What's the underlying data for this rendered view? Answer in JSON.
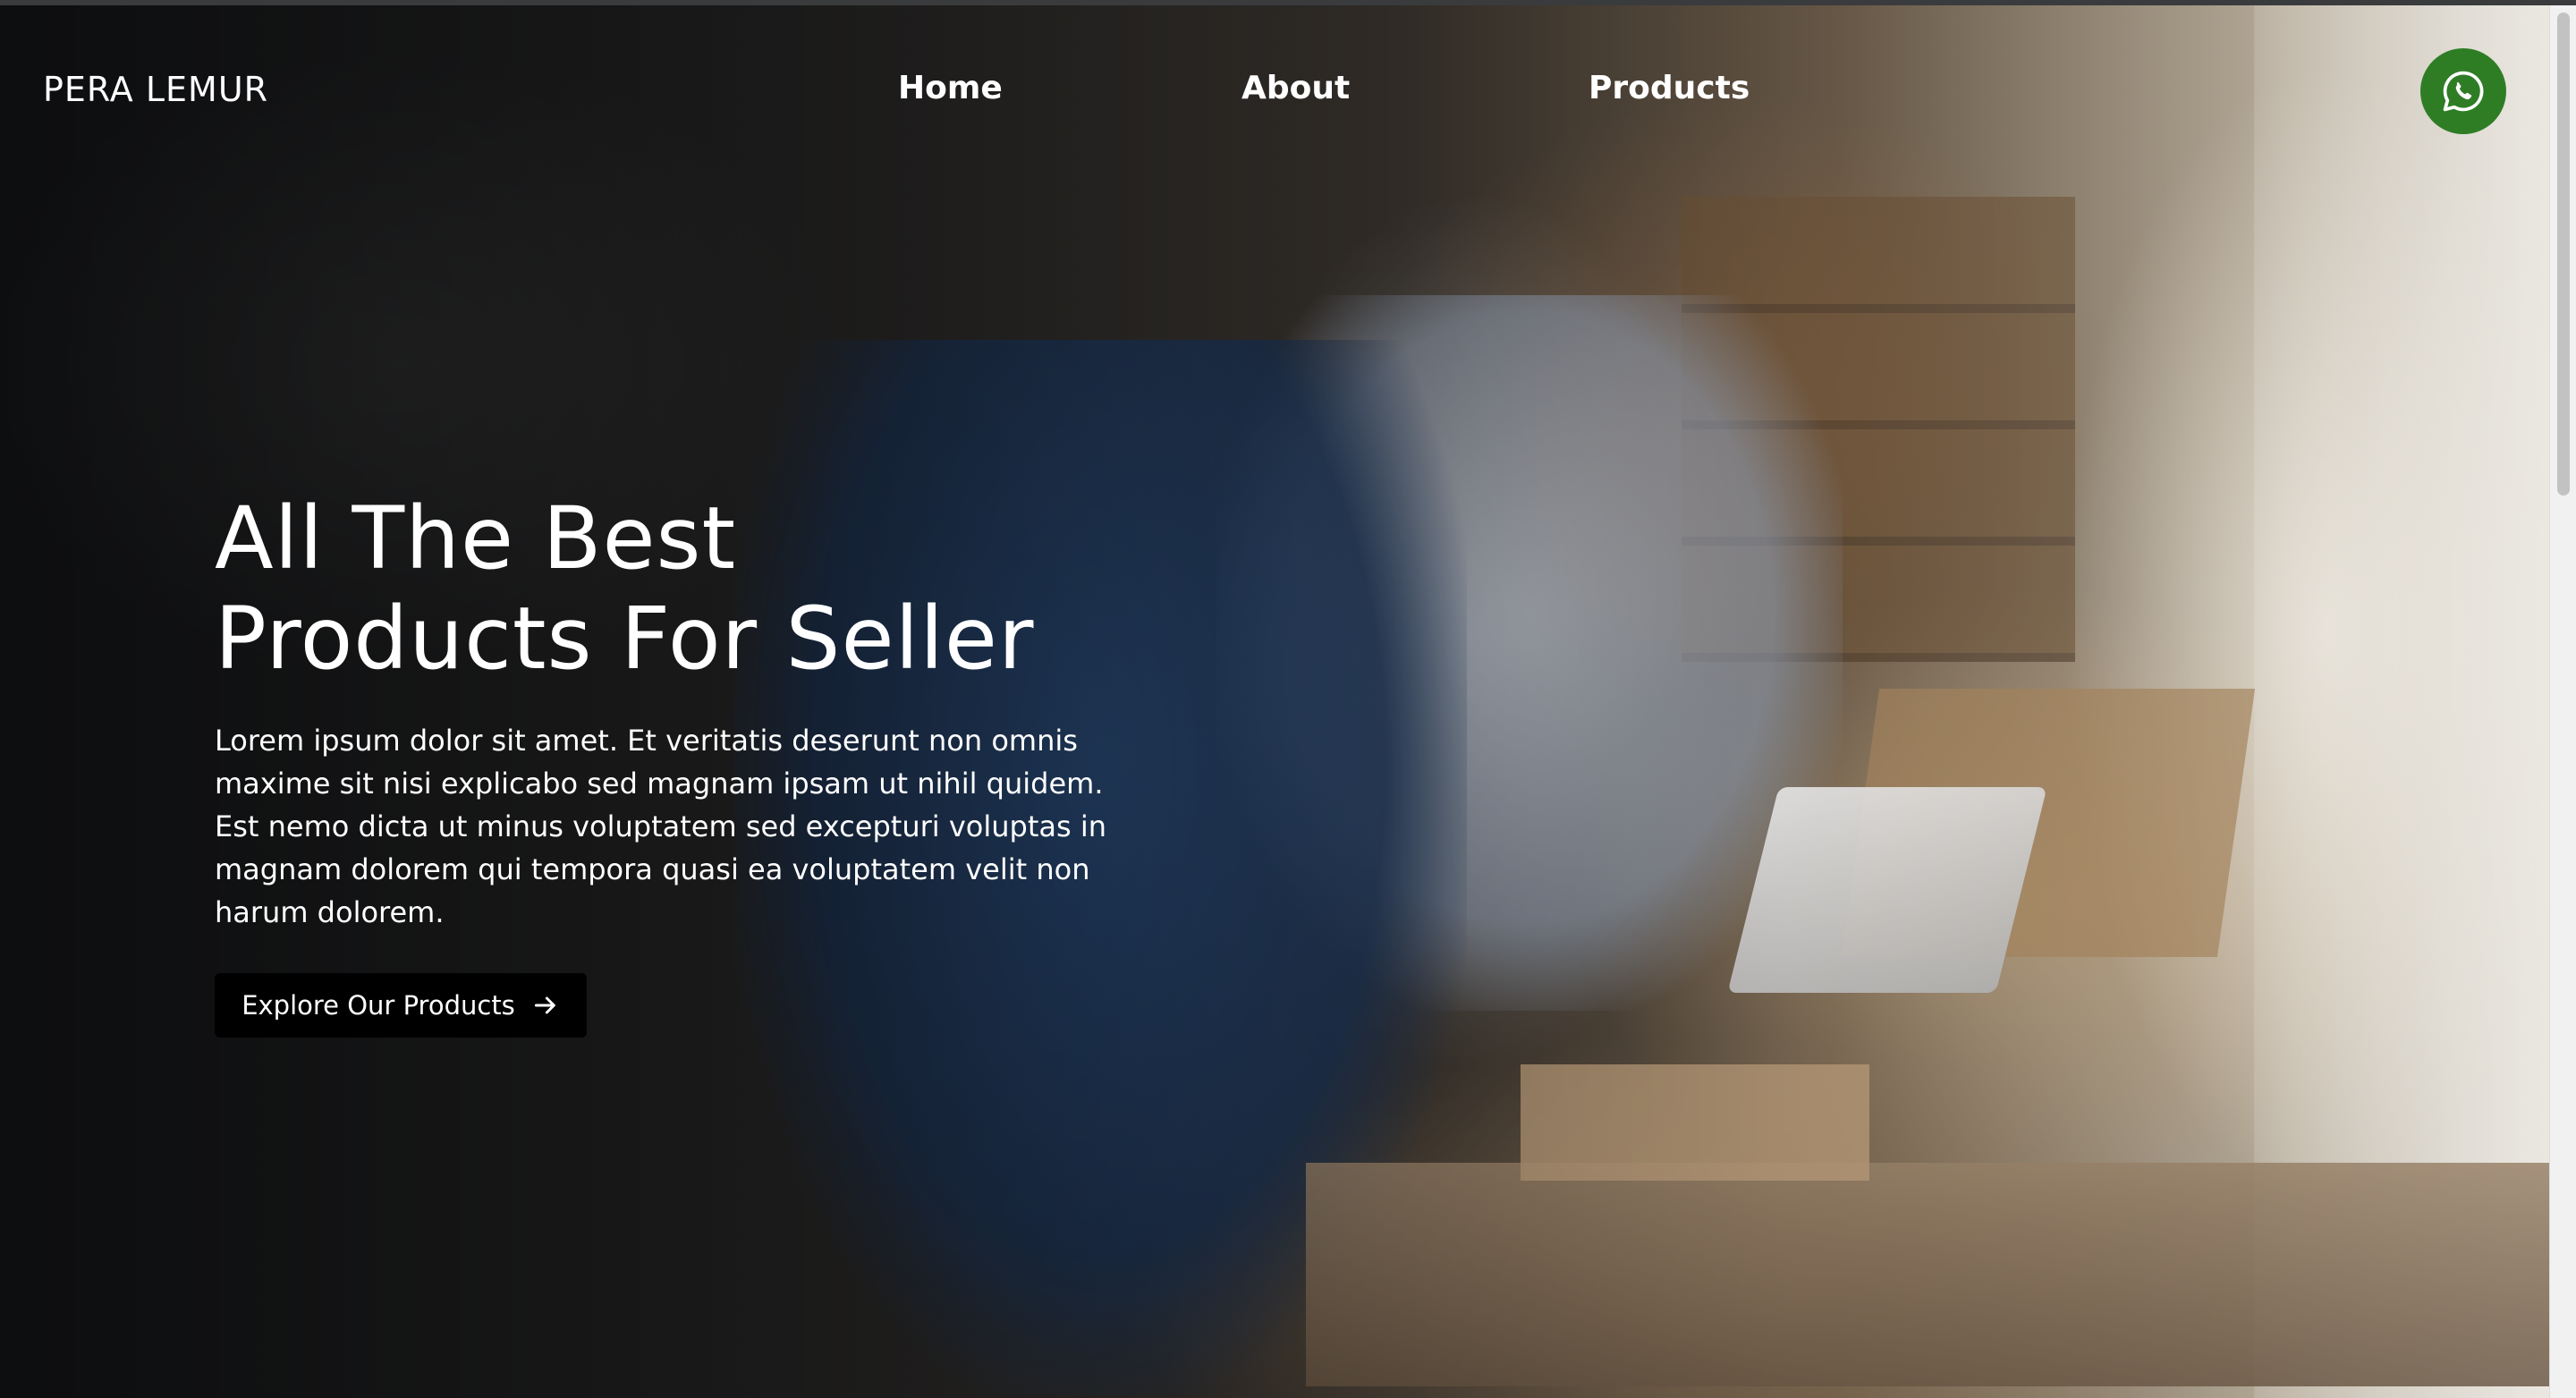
{
  "header": {
    "brand": "PERA LEMUR",
    "nav": [
      {
        "label": "Home"
      },
      {
        "label": "About"
      },
      {
        "label": "Products"
      }
    ],
    "whatsapp_icon": "whatsapp-icon",
    "whatsapp_color": "#2e7d25"
  },
  "hero": {
    "title_line1": "All The Best",
    "title_line2": "Products For Seller",
    "description": "Lorem ipsum dolor sit amet. Et veritatis deserunt non omnis maxime sit nisi explicabo sed magnam ipsam ut nihil quidem. Est nemo dicta ut minus voluptatem sed excepturi voluptas in magnam dolorem qui tempora quasi ea voluptatem velit non harum dolorem.",
    "cta_label": "Explore Our Products",
    "cta_icon": "arrow-right-icon"
  }
}
